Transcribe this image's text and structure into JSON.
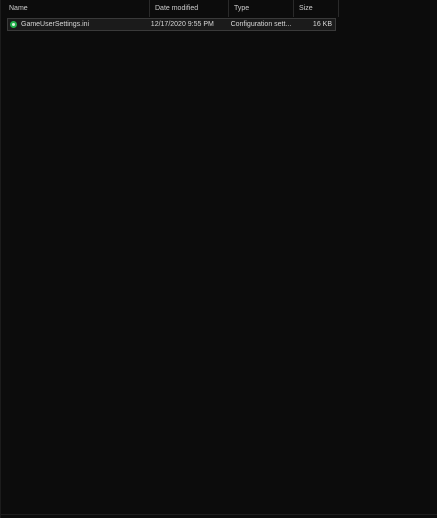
{
  "columns": {
    "name": "Name",
    "date_modified": "Date modified",
    "type": "Type",
    "size": "Size"
  },
  "files": [
    {
      "icon": "config-file-icon",
      "name": "GameUserSettings.ini",
      "date_modified": "12/17/2020 9:55 PM",
      "type": "Configuration sett...",
      "size": "16 KB"
    }
  ],
  "colors": {
    "background": "#0c0c0c",
    "row_selected": "#1b1b1b",
    "icon_green": "#22b14c"
  }
}
